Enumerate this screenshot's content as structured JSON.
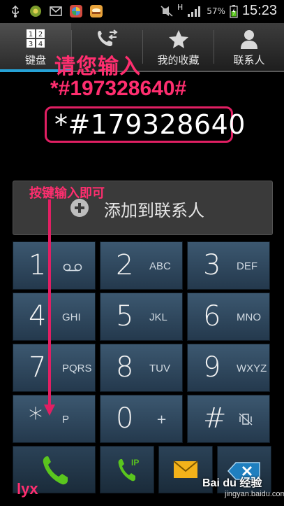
{
  "status_bar": {
    "icons_left": [
      "usb-icon",
      "app-icon",
      "mail-icon",
      "chrome-like-icon",
      "food-app-icon"
    ],
    "signal_letter": "H",
    "battery_percent": "57%",
    "time": "15:23"
  },
  "tabs": [
    {
      "label": "键盘",
      "icon": "keypad-icon",
      "active": true
    },
    {
      "label": "",
      "icon": "call-log-icon",
      "active": false
    },
    {
      "label": "我的收藏",
      "icon": "star-icon",
      "active": false
    },
    {
      "label": "联系人",
      "icon": "person-icon",
      "active": false
    }
  ],
  "annotations": {
    "title": "请您输入",
    "code": "*#197328640#",
    "hint": "按键输入即可"
  },
  "dial_input": {
    "value": "*#179328640"
  },
  "add_contact": {
    "label": "添加到联系人"
  },
  "keypad": [
    {
      "digit": "1",
      "letters": ""
    },
    {
      "digit": "2",
      "letters": "ABC"
    },
    {
      "digit": "3",
      "letters": "DEF"
    },
    {
      "digit": "4",
      "letters": "GHI"
    },
    {
      "digit": "5",
      "letters": "JKL"
    },
    {
      "digit": "6",
      "letters": "MNO"
    },
    {
      "digit": "7",
      "letters": "PQRS"
    },
    {
      "digit": "8",
      "letters": "TUV"
    },
    {
      "digit": "9",
      "letters": "WXYZ"
    },
    {
      "digit": "*",
      "letters": "P"
    },
    {
      "digit": "0",
      "letters": "+"
    },
    {
      "digit": "#",
      "letters": ""
    }
  ],
  "actions": {
    "ip_call_label": "IP"
  },
  "watermarks": {
    "author": "lyx",
    "brand": "Bai du 经验",
    "url": "jingyan.baidu.com"
  },
  "colors": {
    "annotation": "#ff2e6f",
    "call_green": "#5ac51e",
    "message_yellow": "#f3b21a",
    "delete_blue": "#1f7fbf",
    "tab_active": "#26a2d6"
  }
}
